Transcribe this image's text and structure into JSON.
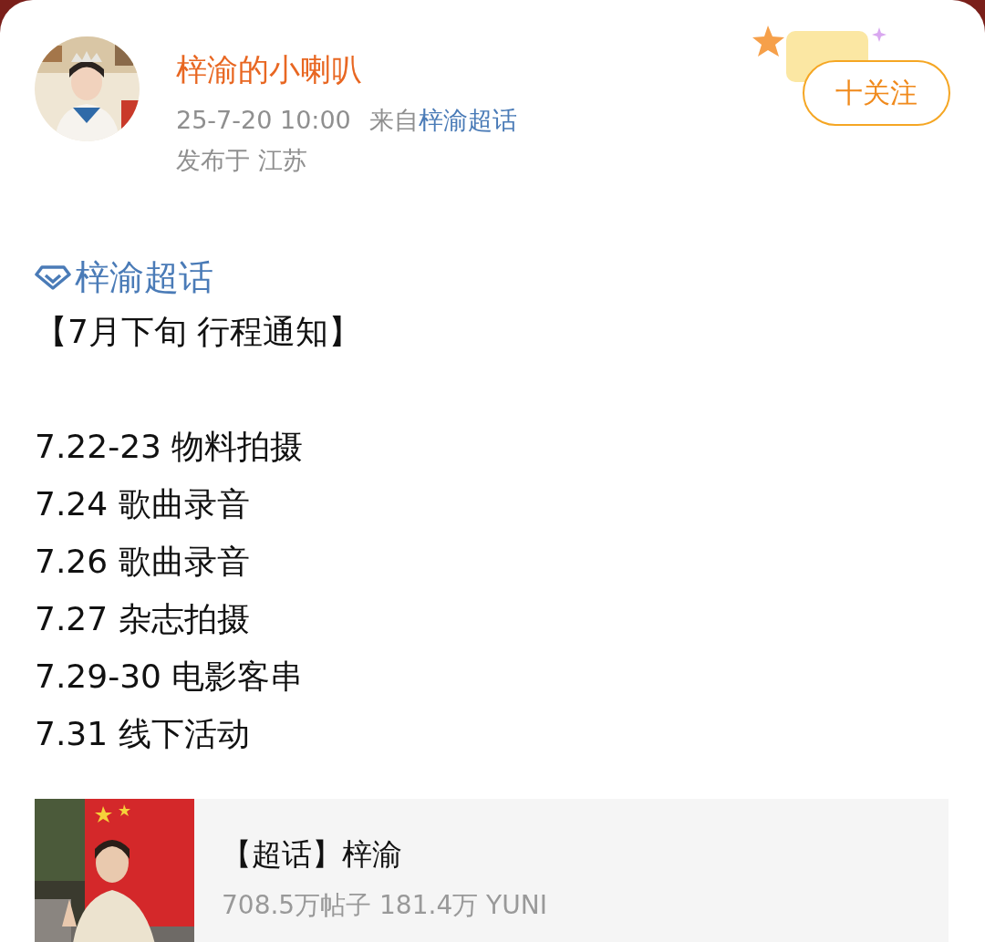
{
  "author": {
    "name": "梓渝的小喇叭",
    "time": "25-7-20 10:00",
    "source_prefix": "来自",
    "source_link": "梓渝超话",
    "location": "发布于 江苏",
    "follow_button": "十关注",
    "followed": false
  },
  "post": {
    "topic_link": "梓渝超话",
    "heading": "【7月下旬 行程通知】",
    "lines": [
      "7.22-23 物料拍摄",
      "7.24 歌曲录音",
      "7.26 歌曲录音",
      "7.27 杂志拍摄",
      "7.29-30 电影客串",
      "7.31 线下活动"
    ]
  },
  "topic_card": {
    "kind": "picture",
    "title": "【超话】梓渝",
    "stats": "708.5万帖子 181.4万 YUNI"
  }
}
